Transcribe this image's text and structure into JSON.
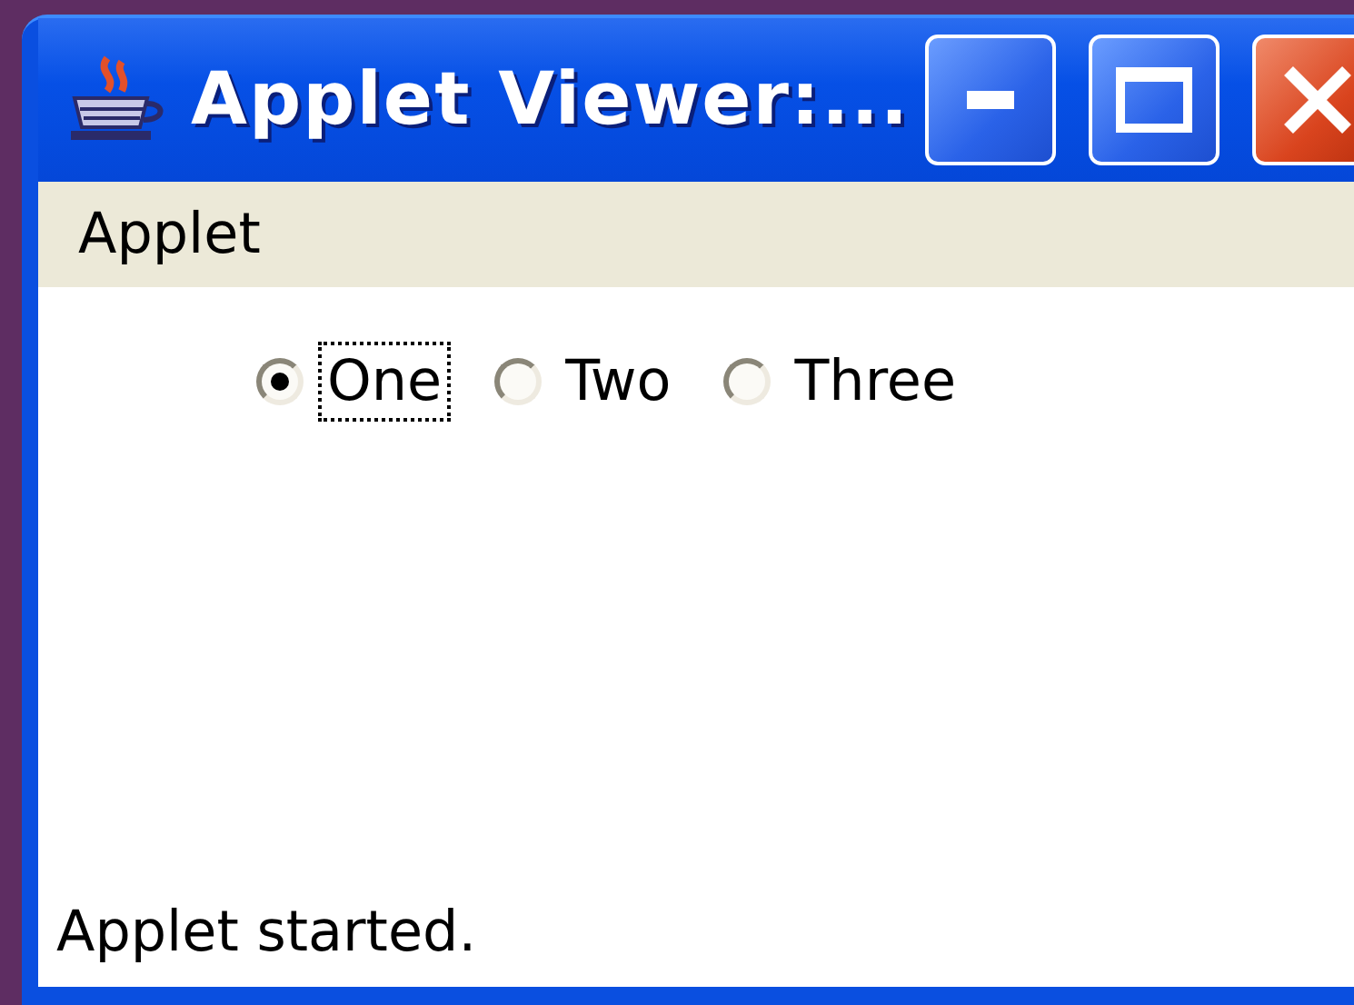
{
  "window": {
    "title": "Applet Viewer:..."
  },
  "menu_bar": {
    "items": [
      "Applet"
    ]
  },
  "radio_group": [
    {
      "label": "One",
      "selected": true,
      "focused": true
    },
    {
      "label": "Two",
      "selected": false,
      "focused": false
    },
    {
      "label": "Three",
      "selected": false,
      "focused": false
    }
  ],
  "status_bar": "Applet started."
}
